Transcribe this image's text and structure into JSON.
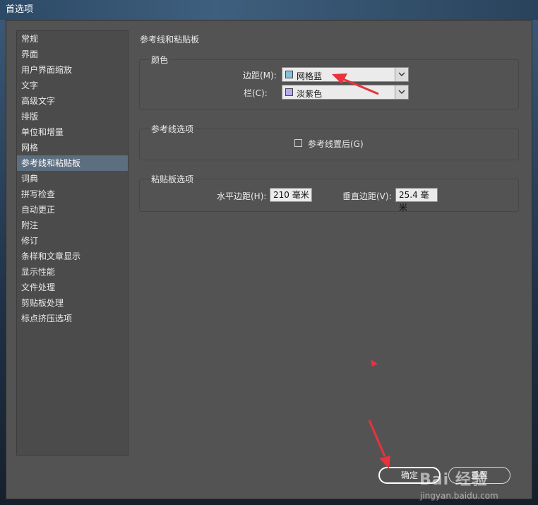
{
  "window": {
    "title": "首选项"
  },
  "sidebar": {
    "items": [
      {
        "label": "常规"
      },
      {
        "label": "界面"
      },
      {
        "label": "用户界面缩放"
      },
      {
        "label": "文字"
      },
      {
        "label": "高级文字"
      },
      {
        "label": "排版"
      },
      {
        "label": "单位和增量"
      },
      {
        "label": "网格"
      },
      {
        "label": "参考线和粘贴板",
        "selected": true
      },
      {
        "label": "词典"
      },
      {
        "label": "拼写检查"
      },
      {
        "label": "自动更正"
      },
      {
        "label": "附注"
      },
      {
        "label": "修订"
      },
      {
        "label": "条样和文章显示"
      },
      {
        "label": "显示性能"
      },
      {
        "label": "文件处理"
      },
      {
        "label": "剪贴板处理"
      },
      {
        "label": "标点挤压选项"
      }
    ]
  },
  "main": {
    "title": "参考线和粘贴板",
    "color_group": {
      "title": "颜色",
      "margin": {
        "label": "边距(M):",
        "value": "网格蓝",
        "swatch": "#7ec3de"
      },
      "column": {
        "label": "栏(C):",
        "value": "淡紫色",
        "swatch": "#b9a8f0"
      }
    },
    "guide_options": {
      "title": "参考线选项",
      "guides_in_back": {
        "label": "参考线置后(G)",
        "checked": false
      }
    },
    "pasteboard_options": {
      "title": "粘贴板选项",
      "horizontal_margin": {
        "label": "水平边距(H):",
        "value": "210 毫米"
      },
      "vertical_margin": {
        "label": "垂直边距(V):",
        "value": "25.4 毫米"
      }
    }
  },
  "buttons": {
    "ok": "确定",
    "reset": "重置"
  },
  "watermark": {
    "text": "Bai 经验",
    "url": "jingyan.baidu.com"
  },
  "colors": {
    "annotation_arrow": "#e8323c",
    "dialog_bg": "#535353",
    "selected_item": "#5d6e80"
  }
}
